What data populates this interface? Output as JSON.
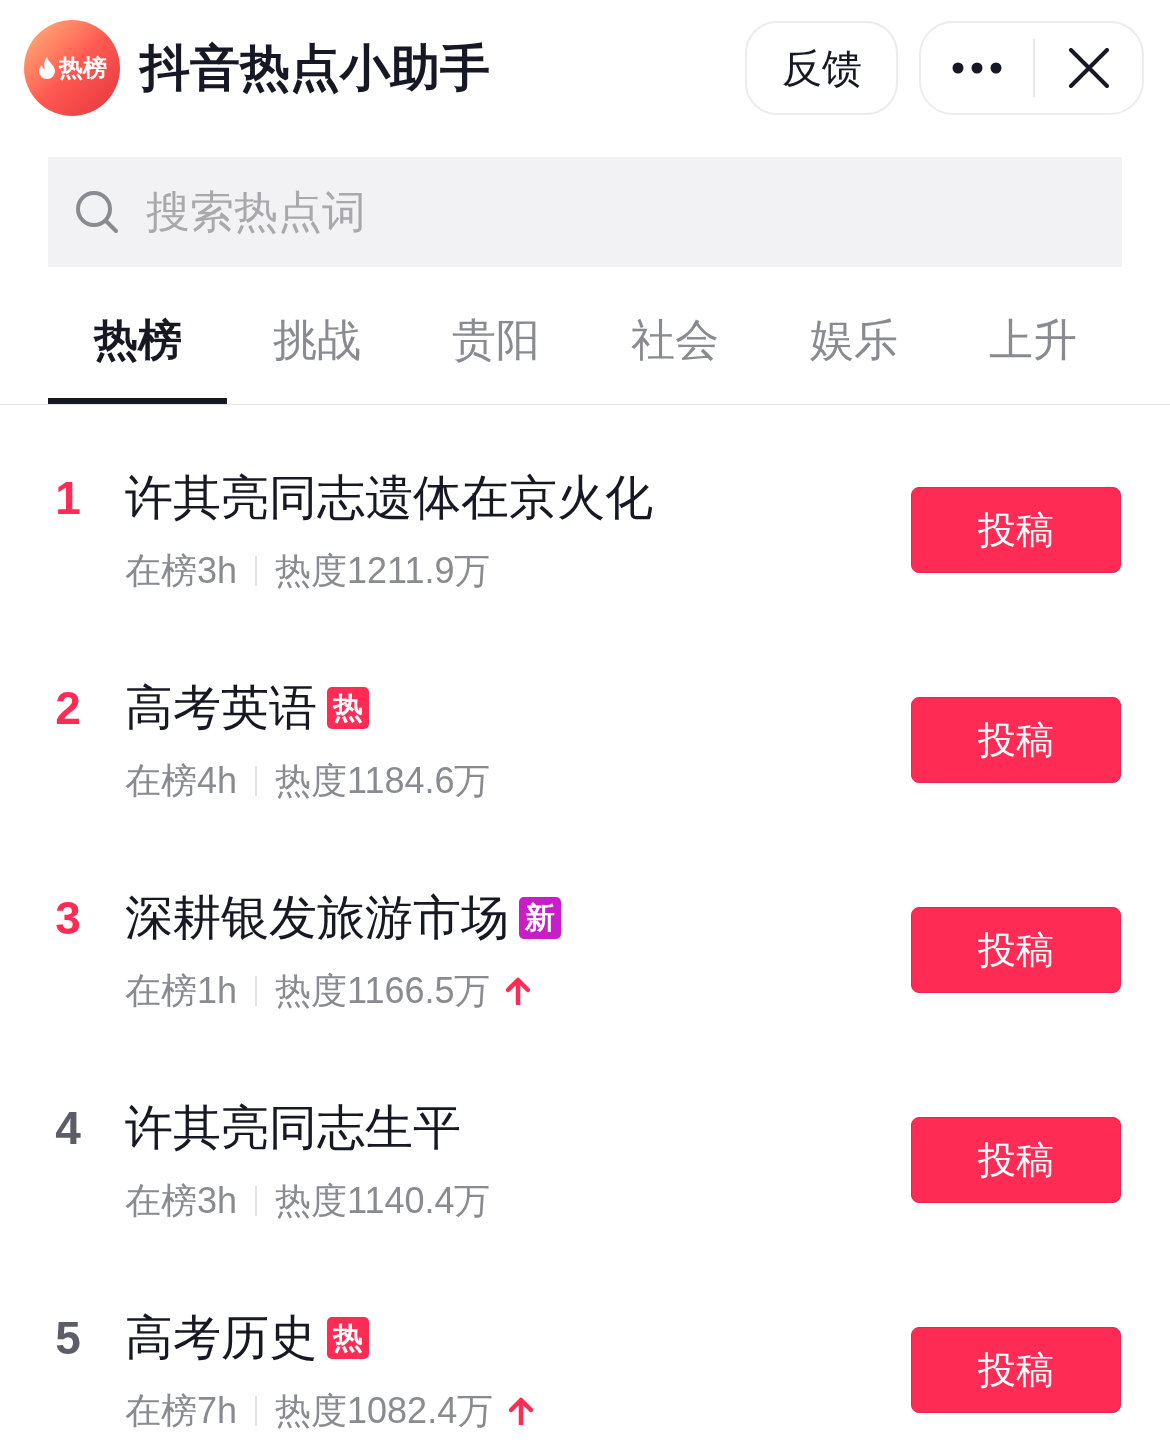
{
  "header": {
    "logo_text": "热榜",
    "title": "抖音热点小助手",
    "feedback_button": "反馈"
  },
  "search": {
    "placeholder": "搜索热点词"
  },
  "tabs": [
    {
      "label": "热榜",
      "selected": true
    },
    {
      "label": "挑战",
      "selected": false
    },
    {
      "label": "贵阳",
      "selected": false
    },
    {
      "label": "社会",
      "selected": false
    },
    {
      "label": "娱乐",
      "selected": false
    },
    {
      "label": "上升",
      "selected": false
    }
  ],
  "rows": [
    {
      "rank": "1",
      "highlighted": true,
      "title": "许其亮同志遗体在京火化",
      "on_list": "在榜3h",
      "heat": "热度1211.9万",
      "rising": false,
      "button": "投稿"
    },
    {
      "rank": "2",
      "highlighted": true,
      "title": "高考英语",
      "badge": {
        "text": "热",
        "color": "#fe2c55"
      },
      "on_list": "在榜4h",
      "heat": "热度1184.6万",
      "rising": false,
      "button": "投稿"
    },
    {
      "rank": "3",
      "highlighted": true,
      "title": "深耕银发旅游市场",
      "badge": {
        "text": "新",
        "color": "#c81dc8"
      },
      "on_list": "在榜1h",
      "heat": "热度1166.5万",
      "rising": true,
      "button": "投稿"
    },
    {
      "rank": "4",
      "highlighted": false,
      "title": "许其亮同志生平",
      "on_list": "在榜3h",
      "heat": "热度1140.4万",
      "rising": false,
      "button": "投稿"
    },
    {
      "rank": "5",
      "highlighted": false,
      "title": "高考历史",
      "badge": {
        "text": "热",
        "color": "#fe2c55"
      },
      "on_list": "在榜7h",
      "heat": "热度1082.4万",
      "rising": true,
      "button": "投稿"
    }
  ]
}
